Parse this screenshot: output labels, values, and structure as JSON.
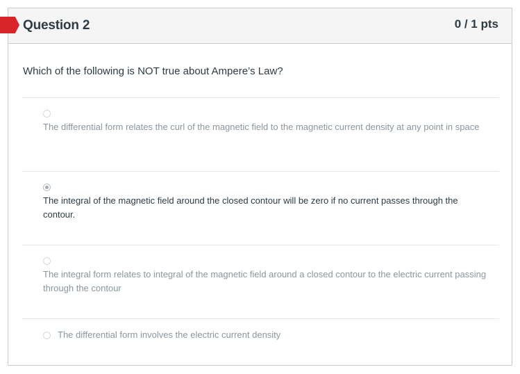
{
  "question": {
    "title": "Question 2",
    "points": "0 / 1 pts",
    "text": "Which of the following is NOT true about Ampere’s Law?"
  },
  "answers": [
    {
      "text": "The differential form relates the curl of the magnetic field to the magnetic current density at any point in space",
      "selected": false
    },
    {
      "text": "The integral of the magnetic field around the closed contour will be zero if no current passes through the contour.",
      "selected": true
    },
    {
      "text": "The integral form relates to integral of the magnetic field around a closed contour to the electric current passing through the contour",
      "selected": false
    },
    {
      "text": "The differential form involves the electric current density",
      "selected": false
    }
  ],
  "colors": {
    "flag": "#d9232a",
    "header_bg": "#f5f5f5",
    "text_dark": "#2d3b45",
    "text_muted": "#8b969e"
  }
}
